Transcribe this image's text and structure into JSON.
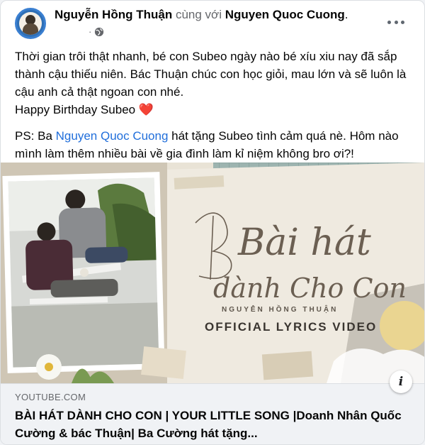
{
  "post": {
    "author": "Nguyễn Hồng Thuận",
    "with_text": "cùng với",
    "tagged": "Nguyen Quoc Cuong",
    "tagged_suffix": ".",
    "meta_dot": "·",
    "privacy_icon": "globe-icon",
    "more_icon": "more-dots-icon",
    "paragraph1": "Thời gian trôi thật nhanh, bé con Subeo ngày nào bé xíu xiu nay đã sắp thành cậu thiếu niên. Bác Thuận chúc con học giỏi, mau lớn và sẽ luôn là cậu anh cả thật ngoan con nhé.",
    "birthday_line": "Happy Birthday Subeo",
    "heart_emoji": "❤️",
    "ps_prefix": "PS: Ba",
    "ps_mention": "Nguyen Quoc Cuong",
    "ps_rest": "hát tặng Subeo tình cảm quá nè. Hôm nào mình làm thêm nhiều bài về gia đình làm kỉ niệm không bro ơi?!"
  },
  "thumbnail": {
    "script_line1": "Bài hát",
    "script_line2": "dành Cho Con",
    "byline": "NGUYỄN HỒNG THUẬN",
    "label": "OFFICIAL LYRICS VIDEO",
    "info_icon": "info-icon",
    "info_glyph": "i"
  },
  "link_preview": {
    "domain": "YOUTUBE.COM",
    "title": "BÀI HÁT DÀNH CHO CON | YOUR LITTLE SONG |Doanh Nhân Quốc Cường & bác Thuận| Ba Cường hát tặng..."
  },
  "colors": {
    "mention": "#216fdb",
    "text": "#050505",
    "secondary": "#65676b",
    "avatar_ring": "#3a7fd1"
  }
}
